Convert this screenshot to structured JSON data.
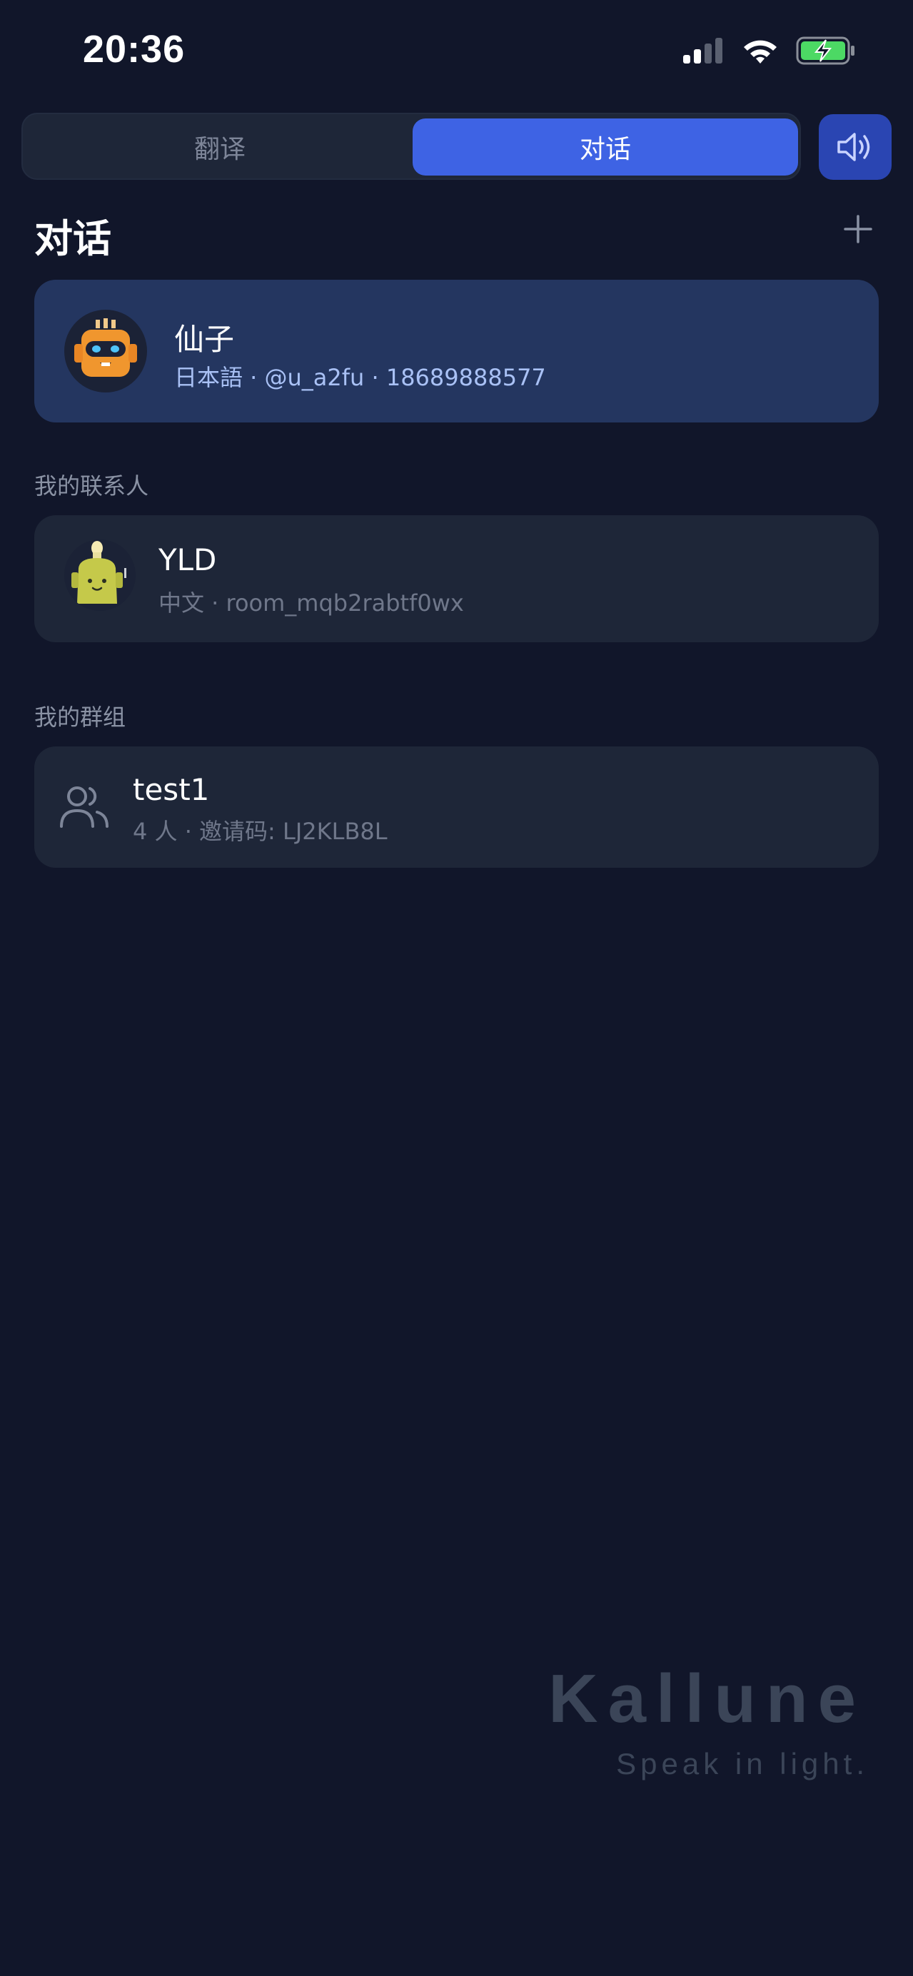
{
  "status_bar": {
    "time": "20:36"
  },
  "tabs": [
    {
      "label": "翻译",
      "active": false
    },
    {
      "label": "对话",
      "active": true
    }
  ],
  "header": {
    "title": "对话"
  },
  "current_conversation": {
    "name": "仙子",
    "meta": "日本語 · @u_a2fu · 18689888577",
    "avatar_icon": "orange-robot-avatar"
  },
  "contacts_section": {
    "label": "我的联系人",
    "items": [
      {
        "name": "YLD",
        "meta": "中文 · room_mqb2rabtf0wx",
        "avatar_icon": "green-robot-avatar"
      }
    ]
  },
  "groups_section": {
    "label": "我的群组",
    "items": [
      {
        "name": "test1",
        "meta": "4 人 · 邀请码: LJ2KLB8L",
        "icon": "users-icon"
      }
    ]
  },
  "branding": {
    "name": "Kallune",
    "tagline": "Speak in light."
  },
  "colors": {
    "background": "#11162a",
    "accent": "#3e63e4",
    "current_card": "#243660",
    "card": "#1e2638"
  }
}
